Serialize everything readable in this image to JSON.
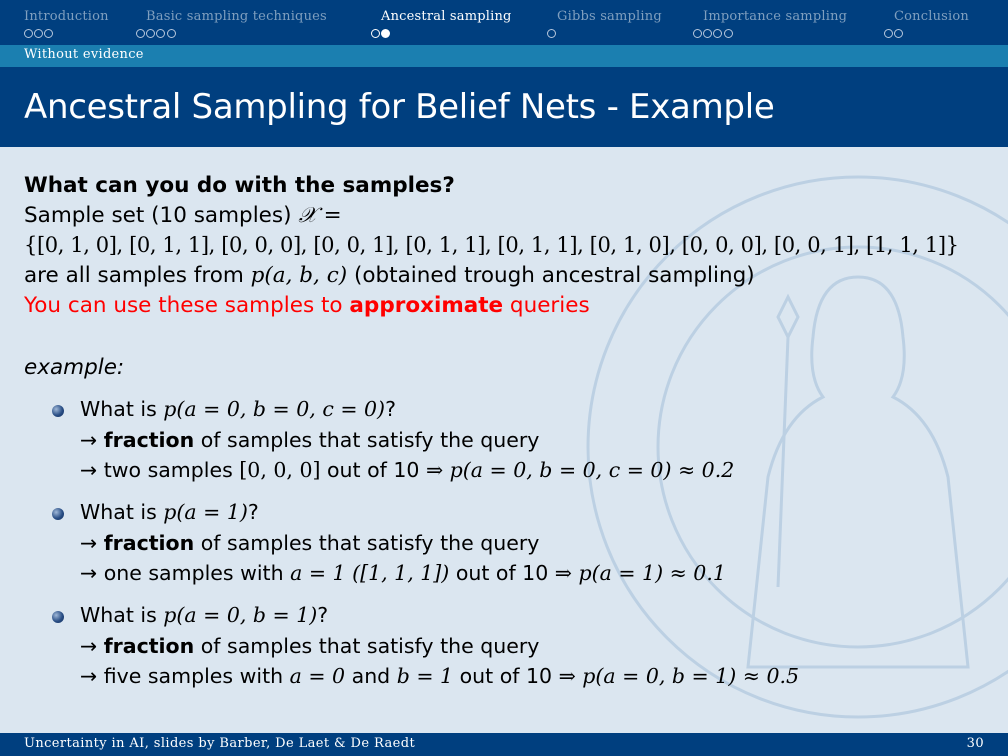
{
  "nav": {
    "sections": [
      {
        "label": "Introduction",
        "dots": 3,
        "filled": 0,
        "active": false
      },
      {
        "label": "Basic sampling techniques",
        "dots": 4,
        "filled": 0,
        "active": false
      },
      {
        "label": "Ancestral sampling",
        "dots": 2,
        "filled": 1,
        "active": true
      },
      {
        "label": "Gibbs sampling",
        "dots": 1,
        "filled": 0,
        "active": false
      },
      {
        "label": "Importance sampling",
        "dots": 4,
        "filled": 0,
        "active": false
      },
      {
        "label": "Conclusion",
        "dots": 2,
        "filled": 0,
        "active": false
      }
    ],
    "subsection": "Without evidence"
  },
  "title": "Ancestral Sampling for Belief Nets - Example",
  "body": {
    "heading": "What can you do with the samples?",
    "sample_set_text": "Sample set (10 samples) ",
    "sample_set_symbol": "𝒳 =",
    "samples": "{[0, 1, 0], [0, 1, 1], [0, 0, 0], [0, 0, 1], [0, 1, 1], [0, 1, 1], [0, 1, 0], [0, 0, 0], [0, 0, 1], [1, 1, 1]}",
    "from_prefix": "are all samples from ",
    "from_math": "p(a, b, c)",
    "from_suffix": " (obtained trough ancestral sampling)",
    "use_prefix": "You can use these samples to ",
    "use_bold": "approximate",
    "use_suffix": " queries",
    "example_label": "example:",
    "bullets": [
      {
        "q_prefix": "What is ",
        "q_math": "p(a = 0, b = 0, c = 0)",
        "q_suffix": "?",
        "l1_arrow": "→ ",
        "l1_bold": "fraction",
        "l1_rest": "  of samples that satisfy the query",
        "l2_arrow": "→ ",
        "l2_text": "two samples ",
        "l2_math1": "[0, 0, 0]",
        "l2_mid": " out of 10 ",
        "l2_math2": "⇒ p(a = 0, b = 0, c = 0) ≈ 0.2"
      },
      {
        "q_prefix": "What is ",
        "q_math": "p(a = 1)",
        "q_suffix": "?",
        "l1_arrow": "→ ",
        "l1_bold": "fraction",
        "l1_rest": "  of samples that satisfy the query",
        "l2_arrow": "→ ",
        "l2_text": "one samples with ",
        "l2_math1": "a = 1 ([1, 1, 1])",
        "l2_mid": " out of 10 ",
        "l2_math2": "⇒ p(a = 1) ≈ 0.1"
      },
      {
        "q_prefix": "What is ",
        "q_math": "p(a = 0, b = 1)",
        "q_suffix": "?",
        "l1_arrow": "→ ",
        "l1_bold": "fraction",
        "l1_rest": "  of samples that satisfy the query",
        "l2_arrow": "→ ",
        "l2_text": "five samples with ",
        "l2_math1": "a = 0",
        "l2_mid": " and ",
        "l2_math2": "b = 1",
        "l2_tail": " out of 10 ",
        "l2_math3": "⇒ p(a = 0, b = 1) ≈ 0.5"
      }
    ]
  },
  "footer": {
    "left": "Uncertainty in AI, slides by Barber, De Laet & De Raedt",
    "page": "30"
  },
  "colors": {
    "bar": "#003f7f",
    "subsection_bar": "#1b7fb0",
    "content_bg": "#dbe6f0",
    "accent_red": "#ff0000"
  }
}
